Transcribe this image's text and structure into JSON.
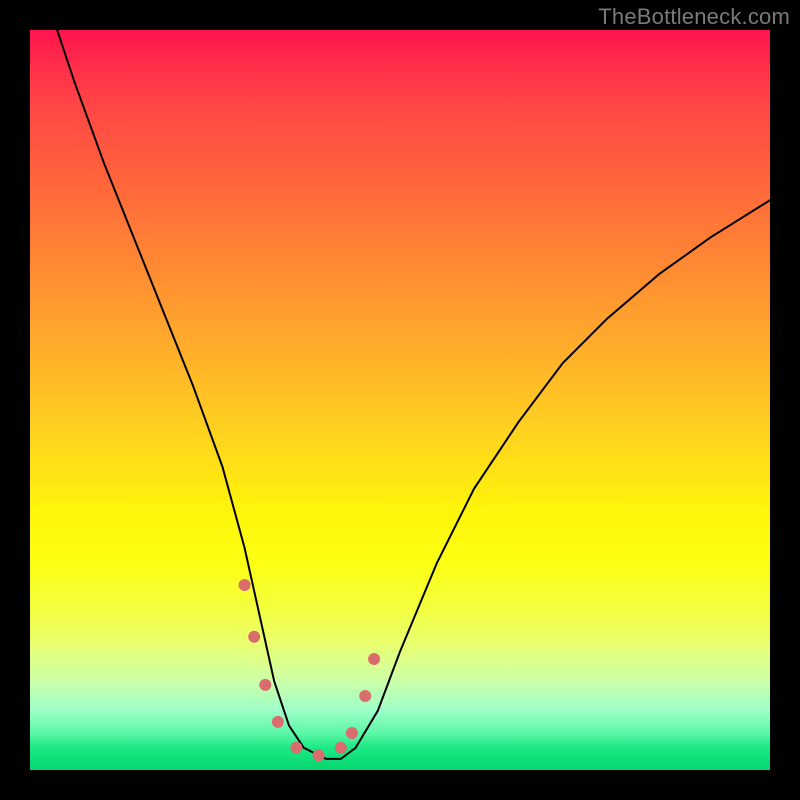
{
  "watermark": "TheBottleneck.com",
  "chart_data": {
    "type": "line",
    "title": "",
    "xlabel": "",
    "ylabel": "",
    "xlim": [
      0,
      100
    ],
    "ylim": [
      0,
      100
    ],
    "series": [
      {
        "name": "bottleneck-curve",
        "x": [
          0,
          3,
          6,
          10,
          14,
          18,
          22,
          26,
          29,
          31,
          33,
          35,
          37,
          40,
          42,
          44,
          47,
          50,
          55,
          60,
          66,
          72,
          78,
          85,
          92,
          100
        ],
        "y": [
          110,
          102,
          93,
          82,
          72,
          62,
          52,
          41,
          30,
          21,
          12,
          6,
          3,
          1.5,
          1.5,
          3,
          8,
          16,
          28,
          38,
          47,
          55,
          61,
          67,
          72,
          77
        ],
        "color": "#000000",
        "stroke_width": 2
      }
    ],
    "highlight": {
      "name": "optimal-zone",
      "color": "#d96d6d",
      "points_x": [
        29.0,
        30.3,
        31.8,
        33.5,
        36.0,
        39.0,
        42.0,
        43.5,
        45.3,
        46.5
      ],
      "points_y": [
        25.0,
        18.0,
        11.5,
        6.5,
        3.0,
        2.0,
        3.0,
        5.0,
        10.0,
        15.0
      ],
      "radius": 6
    },
    "background_gradient": {
      "top_color": "#ff144e",
      "bottom_color": "#06d66e"
    }
  }
}
